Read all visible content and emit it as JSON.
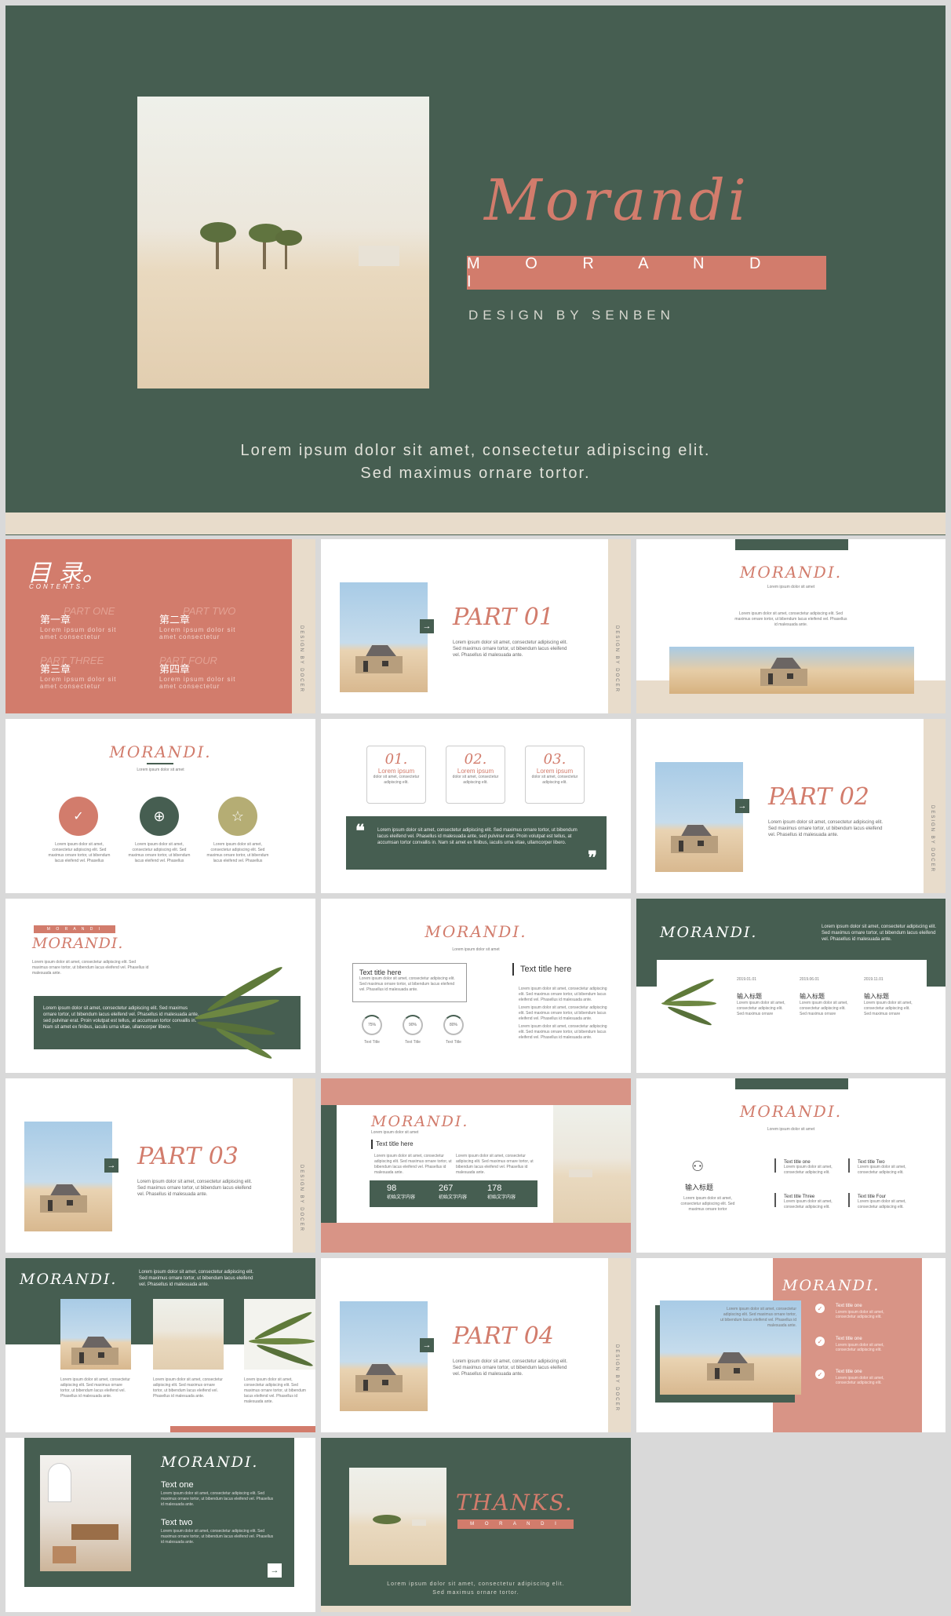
{
  "colors": {
    "green": "#465e51",
    "salmon": "#d27c6c",
    "beige": "#e8dccb",
    "olive": "#b5ad74"
  },
  "cover": {
    "script_title": "Morandi",
    "banner": "M O R A N D I",
    "byline": "DESIGN BY SENBEN",
    "text_line1": "Lorem ipsum dolor sit amet, consectetur adipiscing elit.",
    "text_line2": "Sed maximus ornare tortor."
  },
  "toc": {
    "title": "目 录。",
    "subtitle": "CONTENTS.",
    "items": [
      {
        "ghost": "PART ONE",
        "label": "第一章",
        "desc1": "Lorem ipsum dolor sit",
        "desc2": "amet consectetur"
      },
      {
        "ghost": "PART TWO",
        "label": "第二章",
        "desc1": "Lorem ipsum dolor sit",
        "desc2": "amet consectetur"
      },
      {
        "ghost": "PART THREE",
        "label": "第三章",
        "desc1": "Lorem ipsum dolor sit",
        "desc2": "amet consectetur"
      },
      {
        "ghost": "PART FOUR",
        "label": "第四章",
        "desc1": "Lorem ipsum dolor sit",
        "desc2": "amet consectetur"
      }
    ],
    "vertical": "DESIGN BY DOCER"
  },
  "parts": {
    "p1": "PART 01",
    "p2": "PART 02",
    "p3": "PART 03",
    "p4": "PART 04",
    "body": "Lorem ipsum dolor sit amet, consectetur adipiscing elit. Sed maximus ornare tortor, ut bibendum lacus eleifend vel. Phasellus id malesuada ante.",
    "vertical": "DESIGN BY DOCER"
  },
  "brand": "MORANDI.",
  "brand_spaced": "M O R A N D I",
  "sub": "Lorem ipsum dolor sit amet",
  "long_text": "Lorem ipsum dolor sit amet, consectetur adipiscing elit. Sed maximus ornare tortor, ut bibendum lacus eleifend vel. Phasellus id malesuada ante.",
  "quote_text": "Lorem ipsum dolor sit amet, consectetur adipiscing elit. Sed maximus ornare tortor, ut bibendum lacus eleifend vel. Phasellus id malesuada ante, sed pulvinar erat. Proin volutpat est tellus, at accumsan tortor convallis in. Nam sit amet ex finibus, iaculis urna vitae, ullamcorper libero.",
  "steps": [
    {
      "num": "01.",
      "title": "Lorem ipsum",
      "desc": "dolor sit amet, consectetur adipiscing elit."
    },
    {
      "num": "02.",
      "title": "Lorem ipsum",
      "desc": "dolor sit amet, consectetur adipiscing elit."
    },
    {
      "num": "03.",
      "title": "Lorem ipsum",
      "desc": "dolor sit amet, consectetur adipiscing elit."
    }
  ],
  "three_icons": [
    {
      "icon": "check-icon",
      "desc": "Lorem ipsum dolor sit amet, consectetur adipiscing elit. Sed maximus ornare tortor, ut bibendum lacus eleifend vel. Phasellus"
    },
    {
      "icon": "plus-icon",
      "desc": "Lorem ipsum dolor sit amet, consectetur adipiscing elit. Sed maximus ornare tortor, ut bibendum lacus eleifend vel. Phasellus"
    },
    {
      "icon": "star-icon",
      "desc": "Lorem ipsum dolor sit amet, consectetur adipiscing elit. Sed maximus ornare tortor, ut bibendum lacus eleifend vel. Phasellus"
    }
  ],
  "title_here": "Text title here",
  "progress": [
    {
      "label": "Text Title",
      "pct": "75%",
      "value": 0.75
    },
    {
      "label": "Text Title",
      "pct": "90%",
      "value": 0.9
    },
    {
      "label": "Text Title",
      "pct": "80%",
      "value": 0.8
    }
  ],
  "timeline": [
    {
      "date": "2019.01.01",
      "title": "输入标题",
      "desc": "Lorem ipsum dolor sit amet, consectetur adipiscing elit. Sed maximus ornare"
    },
    {
      "date": "2019.06.01",
      "title": "输入标题",
      "desc": "Lorem ipsum dolor sit amet, consectetur adipiscing elit. Sed maximus ornare"
    },
    {
      "date": "2019.11.01",
      "title": "输入标题",
      "desc": "Lorem ipsum dolor sit amet, consectetur adipiscing elit. Sed maximus ornare"
    }
  ],
  "stats": [
    {
      "value": "98",
      "label": "初始文字内容"
    },
    {
      "value": "267",
      "label": "初始文字内容"
    },
    {
      "value": "178",
      "label": "初始文字内容"
    }
  ],
  "person": {
    "title": "输入标题",
    "desc": "Lorem ipsum dolor sit amet, consectetur adipiscing elit. Sed maximus ornare tortor"
  },
  "four_titles": [
    "Text title one",
    "Text title Two",
    "Text title Three",
    "Text title Four"
  ],
  "four_desc": "Lorem ipsum dolor sit amet, consectetur adipiscing elit.",
  "check_items": [
    "Text title one",
    "Text title one",
    "Text title one"
  ],
  "check_desc": "Lorem ipsum dolor sit amet, consectetur adipiscing elit.",
  "text_one": "Text one",
  "text_two": "Text two",
  "thanks": "THANKS.",
  "thanks_text1": "Lorem ipsum dolor sit amet, consectetur adipiscing elit.",
  "thanks_text2": "Sed maximus ornare tortor."
}
